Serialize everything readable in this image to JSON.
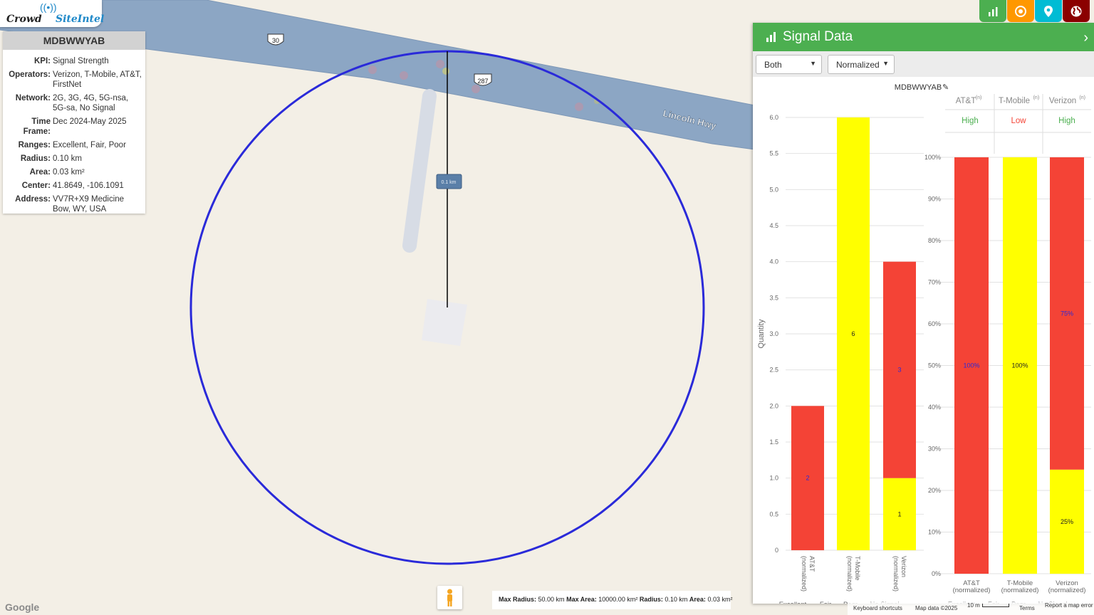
{
  "app": {
    "logo_left": "Crowd",
    "logo_right": "SiteIntel",
    "logo_icon": "broadcast-tower-icon"
  },
  "info": {
    "site_id": "MDBWWYAB",
    "rows": [
      {
        "key": "KPI:",
        "value": "Signal Strength"
      },
      {
        "key": "Operators:",
        "value": "Verizon, T-Mobile, AT&T, FirstNet"
      },
      {
        "key": "Network:",
        "value": "2G, 3G, 4G, 5G-nsa, 5G-sa, No Signal"
      },
      {
        "key": "Time Frame:",
        "value": "Dec 2024-May 2025"
      },
      {
        "key": "Ranges:",
        "value": "Excellent, Fair, Poor"
      },
      {
        "key": "Radius:",
        "value": "0.10 km"
      },
      {
        "key": "Area:",
        "value": "0.03 km²"
      },
      {
        "key": "Center:",
        "value": "41.8649, -106.1091"
      },
      {
        "key": "Address:",
        "value": "VV7R+X9 Medicine Bow, WY, USA"
      }
    ]
  },
  "toolbar": {
    "buttons": [
      {
        "name": "chart-icon",
        "color": "#4caf50"
      },
      {
        "name": "target-icon",
        "color": "#ff9800"
      },
      {
        "name": "location-pin-icon",
        "color": "#00bcd4"
      },
      {
        "name": "globe-icon",
        "color": "#8b0000"
      }
    ]
  },
  "map": {
    "road_label": "Lincoln Hwy",
    "shield_30": "30",
    "shield_287": "287",
    "radius_label": "0.1 km",
    "google": "Google",
    "keyboard": "Keyboard shortcuts",
    "map_data": "Map data ©2025",
    "scale_text": "10 m",
    "terms": "Terms",
    "report": "Report a map error",
    "limits": {
      "max_radius_label": "Max Radius:",
      "max_radius": "50.00 km",
      "max_area_label": "Max Area:",
      "max_area": "10000.00 km²",
      "radius_label": "Radius:",
      "radius": "0.10 km",
      "area_label": "Area:",
      "area": "0.03 km²"
    }
  },
  "panel": {
    "title": "Signal Data",
    "select1": "Both",
    "select2": "Normalized",
    "chart_title": "MDBWWYAB",
    "legend": [
      "Excellent",
      "Fair",
      "Poor",
      "No Signal"
    ],
    "operators": [
      {
        "name": "AT&T",
        "sup": "(n)",
        "rating": "High",
        "rating_color": "#4caf50"
      },
      {
        "name": "T-Mobile",
        "sup": "(n)",
        "rating": "Low",
        "rating_color": "#f44336"
      },
      {
        "name": "Verizon",
        "sup": "(n)",
        "rating": "High",
        "rating_color": "#4caf50"
      }
    ]
  },
  "colors": {
    "excellent": "#4caf50",
    "fair": "#ffff00",
    "poor": "#f44336",
    "no_signal": "#bdbdbd",
    "circle": "#2a2ad9",
    "road": "#8ca6c4"
  },
  "chart_data": [
    {
      "type": "bar",
      "stacked": true,
      "title": "MDBWWYAB",
      "ylabel": "Quantity",
      "ylim": [
        0,
        6
      ],
      "yticks": [
        "0",
        "0.5",
        "1.0",
        "1.5",
        "2.0",
        "2.5",
        "3.0",
        "3.5",
        "4.0",
        "4.5",
        "5.0",
        "5.5",
        "6.0"
      ],
      "categories": [
        "AT&T (normalized)",
        "T-Mobile (normalized)",
        "Verizon (normalized)"
      ],
      "series": [
        {
          "name": "Excellent",
          "values": [
            0,
            0,
            0
          ]
        },
        {
          "name": "Fair",
          "values": [
            0,
            6,
            1
          ]
        },
        {
          "name": "Poor",
          "values": [
            2,
            0,
            3
          ]
        },
        {
          "name": "No Signal",
          "values": [
            0,
            0,
            0
          ]
        }
      ]
    },
    {
      "type": "bar",
      "stacked": true,
      "ylim": [
        0,
        100
      ],
      "yticks": [
        "0%",
        "10%",
        "20%",
        "30%",
        "40%",
        "50%",
        "60%",
        "70%",
        "80%",
        "90%",
        "100%"
      ],
      "categories": [
        "AT&T (normalized)",
        "T-Mobile (normalized)",
        "Verizon (normalized)"
      ],
      "series": [
        {
          "name": "Excellent",
          "values": [
            0,
            0,
            0
          ]
        },
        {
          "name": "Fair",
          "values": [
            0,
            100,
            25
          ]
        },
        {
          "name": "Poor",
          "values": [
            100,
            0,
            75
          ]
        },
        {
          "name": "No Signal",
          "values": [
            0,
            0,
            0
          ]
        }
      ],
      "labels": [
        [
          "100%"
        ],
        [
          "100%"
        ],
        [
          "25%",
          "75%"
        ]
      ]
    }
  ]
}
